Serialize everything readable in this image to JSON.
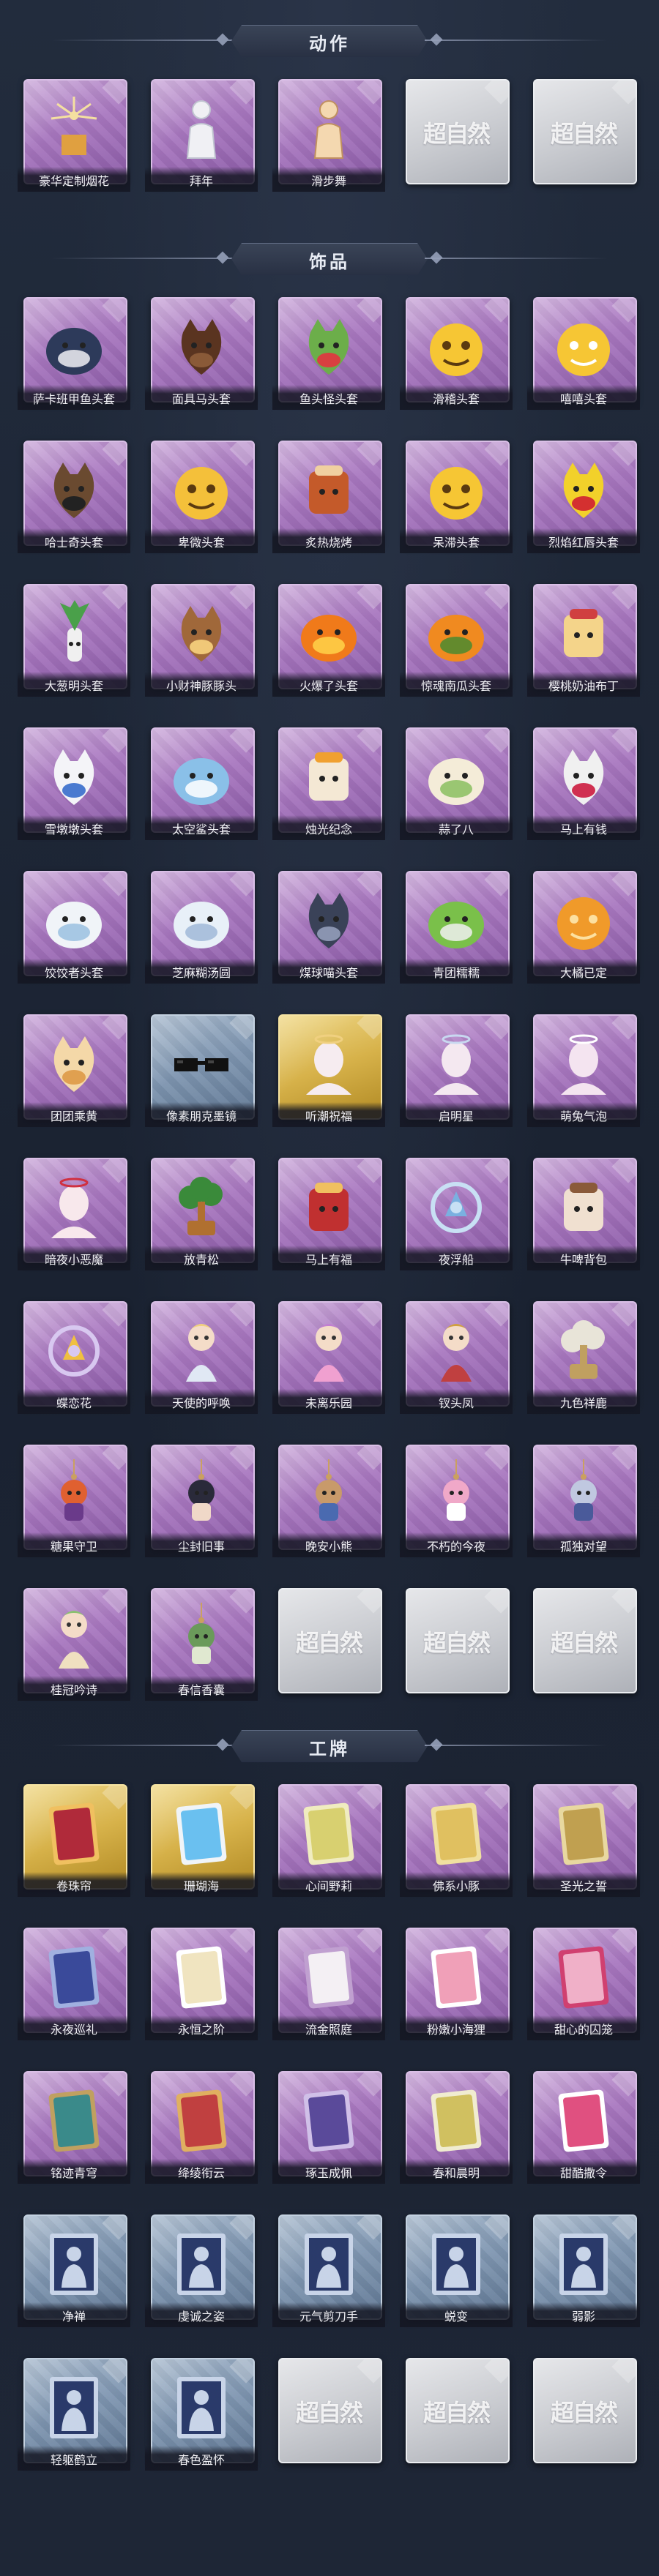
{
  "sections": [
    {
      "title": "动作",
      "items": [
        {
          "label": "豪华定制烟花",
          "rarity": "purple",
          "icon": "fireworks-icon"
        },
        {
          "label": "拜年",
          "rarity": "purple",
          "icon": "bow-gesture-icon"
        },
        {
          "label": "滑步舞",
          "rarity": "purple",
          "icon": "dance-icon"
        },
        {
          "label": "",
          "rarity": "empty",
          "icon": "placeholder-logo"
        },
        {
          "label": "",
          "rarity": "empty",
          "icon": "placeholder-logo"
        }
      ]
    },
    {
      "title": "饰品",
      "items": [
        {
          "label": "萨卡班甲鱼头套",
          "rarity": "purple",
          "icon": "fish-head-icon"
        },
        {
          "label": "面具马头套",
          "rarity": "purple",
          "icon": "horse-head-icon"
        },
        {
          "label": "鱼头怪头套",
          "rarity": "purple",
          "icon": "fish-monster-icon"
        },
        {
          "label": "滑稽头套",
          "rarity": "purple",
          "icon": "smiley-face-icon"
        },
        {
          "label": "嘻嘻头套",
          "rarity": "purple",
          "icon": "grin-face-icon"
        },
        {
          "label": "哈士奇头套",
          "rarity": "purple",
          "icon": "husky-head-icon"
        },
        {
          "label": "卑微头套",
          "rarity": "purple",
          "icon": "sad-face-icon"
        },
        {
          "label": "炙热烧烤",
          "rarity": "purple",
          "icon": "grill-icon"
        },
        {
          "label": "呆滞头套",
          "rarity": "purple",
          "icon": "dazed-face-icon"
        },
        {
          "label": "烈焰红唇头套",
          "rarity": "purple",
          "icon": "pikachu-head-icon"
        },
        {
          "label": "大葱明头套",
          "rarity": "purple",
          "icon": "scallion-icon"
        },
        {
          "label": "小财神豚豚头",
          "rarity": "purple",
          "icon": "pig-head-icon"
        },
        {
          "label": "火爆了头套",
          "rarity": "purple",
          "icon": "flame-head-icon"
        },
        {
          "label": "惊魂南瓜头套",
          "rarity": "purple",
          "icon": "pumpkin-head-icon"
        },
        {
          "label": "樱桃奶油布丁",
          "rarity": "purple",
          "icon": "pudding-icon"
        },
        {
          "label": "雪墩墩头套",
          "rarity": "purple",
          "icon": "snowman-head-icon"
        },
        {
          "label": "太空鲨头套",
          "rarity": "purple",
          "icon": "shark-head-icon"
        },
        {
          "label": "烛光纪念",
          "rarity": "purple",
          "icon": "candle-head-icon"
        },
        {
          "label": "蒜了八",
          "rarity": "purple",
          "icon": "garlic-head-icon"
        },
        {
          "label": "马上有钱",
          "rarity": "purple",
          "icon": "pony-head-icon"
        },
        {
          "label": "饺饺者头套",
          "rarity": "purple",
          "icon": "dumpling-head-icon"
        },
        {
          "label": "芝麻糊汤圆",
          "rarity": "purple",
          "icon": "tangyuan-head-icon"
        },
        {
          "label": "煤球喵头套",
          "rarity": "purple",
          "icon": "black-cat-head-icon"
        },
        {
          "label": "青团糯糯",
          "rarity": "purple",
          "icon": "green-ball-head-icon"
        },
        {
          "label": "大橘已定",
          "rarity": "purple",
          "icon": "orange-slice-icon"
        },
        {
          "label": "团团乘黄",
          "rarity": "purple",
          "icon": "beast-head-icon"
        },
        {
          "label": "像素朋克墨镜",
          "rarity": "blue",
          "icon": "pixel-glasses-icon"
        },
        {
          "label": "听潮祝福",
          "rarity": "gold",
          "icon": "angel-head-icon"
        },
        {
          "label": "启明星",
          "rarity": "purple",
          "icon": "halo-head-icon"
        },
        {
          "label": "萌兔气泡",
          "rarity": "purple",
          "icon": "bunny-bubble-icon"
        },
        {
          "label": "暗夜小恶魔",
          "rarity": "purple",
          "icon": "devil-horns-icon"
        },
        {
          "label": "放青松",
          "rarity": "purple",
          "icon": "bonsai-icon"
        },
        {
          "label": "马上有福",
          "rarity": "purple",
          "icon": "horse-backpack-icon"
        },
        {
          "label": "夜浮船",
          "rarity": "purple",
          "icon": "night-ship-icon"
        },
        {
          "label": "牛啤背包",
          "rarity": "purple",
          "icon": "cow-backpack-icon"
        },
        {
          "label": "蝶恋花",
          "rarity": "purple",
          "icon": "butterfly-icon"
        },
        {
          "label": "天使的呼唤",
          "rarity": "purple",
          "icon": "angel-doll-icon"
        },
        {
          "label": "未离乐园",
          "rarity": "purple",
          "icon": "fairy-doll-icon"
        },
        {
          "label": "钗头凤",
          "rarity": "purple",
          "icon": "phoenix-crown-icon"
        },
        {
          "label": "九色祥鹿",
          "rarity": "purple",
          "icon": "deer-icon"
        },
        {
          "label": "糖果守卫",
          "rarity": "purple",
          "icon": "candy-pendant-icon"
        },
        {
          "label": "尘封旧事",
          "rarity": "purple",
          "icon": "doll-pendant-icon"
        },
        {
          "label": "晚安小熊",
          "rarity": "purple",
          "icon": "bear-pendant-icon"
        },
        {
          "label": "不朽的今夜",
          "rarity": "purple",
          "icon": "pink-pendant-icon"
        },
        {
          "label": "孤独对望",
          "rarity": "purple",
          "icon": "knight-pendant-icon"
        },
        {
          "label": "桂冠吟诗",
          "rarity": "purple",
          "icon": "laurel-doll-icon"
        },
        {
          "label": "春信香囊",
          "rarity": "purple",
          "icon": "sachet-icon"
        },
        {
          "label": "",
          "rarity": "empty",
          "icon": "placeholder-logo"
        },
        {
          "label": "",
          "rarity": "empty",
          "icon": "placeholder-logo"
        },
        {
          "label": "",
          "rarity": "empty",
          "icon": "placeholder-logo"
        }
      ]
    },
    {
      "title": "工牌",
      "items": [
        {
          "label": "卷珠帘",
          "rarity": "gold",
          "icon": "card-red-icon"
        },
        {
          "label": "珊瑚海",
          "rarity": "gold",
          "icon": "card-blue-icon"
        },
        {
          "label": "心间野莉",
          "rarity": "purple",
          "icon": "card-green-icon"
        },
        {
          "label": "佛系小豚",
          "rarity": "purple",
          "icon": "card-yellow-icon"
        },
        {
          "label": "圣光之誓",
          "rarity": "purple",
          "icon": "card-gold-icon"
        },
        {
          "label": "永夜巡礼",
          "rarity": "purple",
          "icon": "card-night-icon"
        },
        {
          "label": "永恒之阶",
          "rarity": "purple",
          "icon": "card-cream-icon"
        },
        {
          "label": "流金照庭",
          "rarity": "purple",
          "icon": "card-white-icon"
        },
        {
          "label": "粉嫩小海狸",
          "rarity": "purple",
          "icon": "card-pink-icon"
        },
        {
          "label": "甜心的囚笼",
          "rarity": "purple",
          "icon": "card-rose-icon"
        },
        {
          "label": "铭迹青穹",
          "rarity": "purple",
          "icon": "card-teal-icon"
        },
        {
          "label": "绛绫衔云",
          "rarity": "purple",
          "icon": "card-crimson-icon"
        },
        {
          "label": "琢玉成佩",
          "rarity": "purple",
          "icon": "card-violet-icon"
        },
        {
          "label": "春和晨明",
          "rarity": "purple",
          "icon": "card-spring-icon"
        },
        {
          "label": "甜酷撒令",
          "rarity": "purple",
          "icon": "card-monster-icon"
        },
        {
          "label": "净禅",
          "rarity": "blue",
          "icon": "silhouette-card-icon"
        },
        {
          "label": "虔诚之姿",
          "rarity": "blue",
          "icon": "silhouette-card-icon"
        },
        {
          "label": "元气剪刀手",
          "rarity": "blue",
          "icon": "silhouette-card-icon"
        },
        {
          "label": "蜕变",
          "rarity": "blue",
          "icon": "silhouette-card-icon"
        },
        {
          "label": "弱影",
          "rarity": "blue",
          "icon": "silhouette-card-icon"
        },
        {
          "label": "轻躯鹤立",
          "rarity": "blue",
          "icon": "silhouette-card-icon"
        },
        {
          "label": "春色盈怀",
          "rarity": "blue",
          "icon": "silhouette-card-icon"
        },
        {
          "label": "",
          "rarity": "empty",
          "icon": "placeholder-logo"
        },
        {
          "label": "",
          "rarity": "empty",
          "icon": "placeholder-logo"
        },
        {
          "label": "",
          "rarity": "empty",
          "icon": "placeholder-logo"
        }
      ]
    }
  ],
  "placeholder_logo_text": "超自然",
  "colors": {
    "background": "#1b2433",
    "purple_frame": "#a978c0",
    "gold_frame": "#d7b24a",
    "blue_frame": "#7e95b0",
    "empty_frame": "#c9cbd0"
  }
}
